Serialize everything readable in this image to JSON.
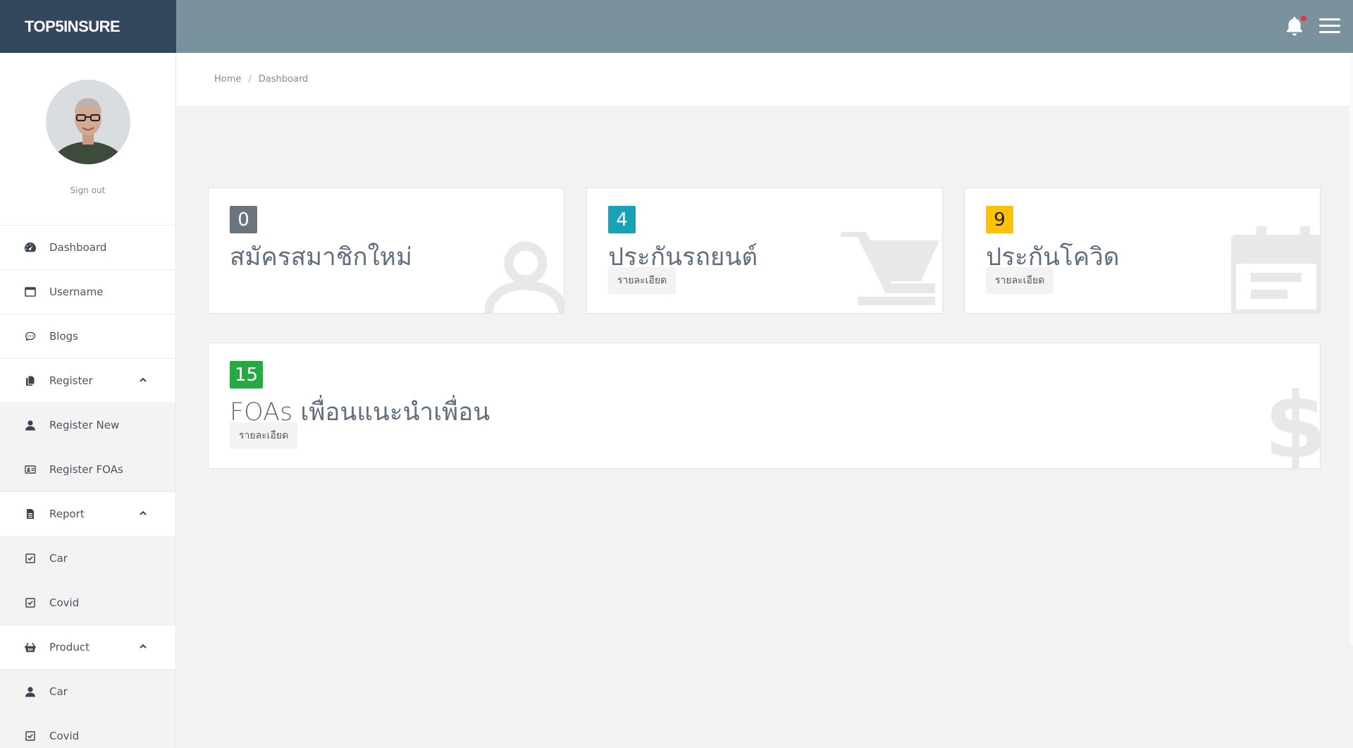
{
  "brand": {
    "name": "TOP5INSURE"
  },
  "topbar": {
    "notification_icon": "bell-icon",
    "menu_icon": "hamburger-icon",
    "notification_color": "#e53935"
  },
  "sidebar": {
    "signout_label": "Sign out",
    "items": [
      {
        "label": "Dashboard",
        "icon": "dashboard-icon"
      },
      {
        "label": "Username",
        "icon": "window-icon"
      },
      {
        "label": "Blogs",
        "icon": "chat-icon"
      },
      {
        "label": "Register",
        "icon": "copy-icon",
        "expanded": true
      },
      {
        "label": "Register New",
        "icon": "user-icon"
      },
      {
        "label": "Register FOAs",
        "icon": "id-card-icon"
      },
      {
        "label": "Report",
        "icon": "file-icon",
        "expanded": true
      },
      {
        "label": "Car",
        "icon": "check-square-icon"
      },
      {
        "label": "Covid",
        "icon": "check-square-icon"
      },
      {
        "label": "Product",
        "icon": "basket-icon",
        "expanded": true
      },
      {
        "label": "Car",
        "icon": "user-icon"
      },
      {
        "label": "Covid",
        "icon": "check-square-icon"
      }
    ]
  },
  "breadcrumb": {
    "home": "Home",
    "separator": "/",
    "current": "Dashboard"
  },
  "cards": [
    {
      "count": "0",
      "title": "สมัครสมาชิกใหม่",
      "detail": "",
      "color": "#6c757d",
      "icon": "user-icon"
    },
    {
      "count": "4",
      "title": "ประกันรถยนต์",
      "detail": "รายละเอียด",
      "color": "#17a2b8",
      "icon": "cart-icon"
    },
    {
      "count": "9",
      "title": "ประกันโควิด",
      "detail": "รายละเอียด",
      "color": "#ffc107",
      "icon": "calendar-icon"
    },
    {
      "count": "15",
      "title": "FOAs เพื่อนแนะนำเพื่อน",
      "detail": "รายละเอียด",
      "color": "#28a745",
      "icon": "dollar-icon"
    }
  ]
}
